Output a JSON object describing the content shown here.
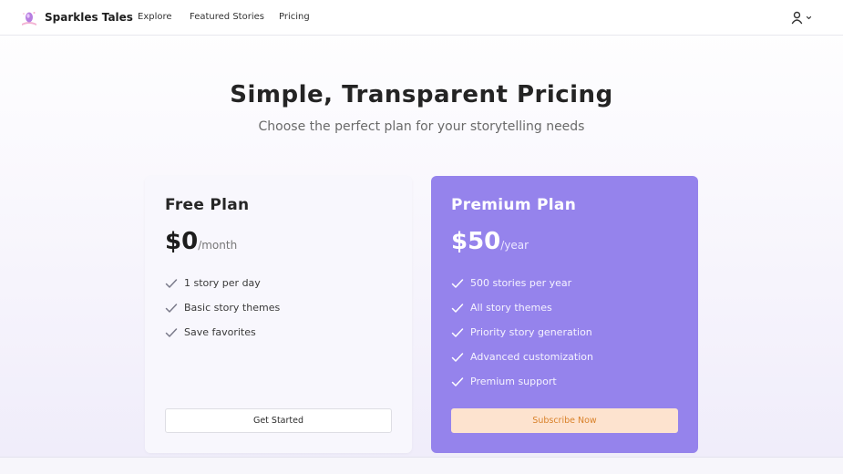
{
  "nav": {
    "brand": "Sparkles Tales",
    "links": [
      "Explore",
      "Featured Stories",
      "Pricing"
    ],
    "logo_icon": "sparkles-book-logo",
    "user_icon": "user-icon",
    "caret_icon": "chevron-down-icon"
  },
  "hero": {
    "title": "Simple, Transparent Pricing",
    "subtitle": "Choose the perfect plan for your storytelling needs"
  },
  "plans": [
    {
      "name": "Free Plan",
      "price": "$0",
      "period": "/month",
      "features": [
        "1 story per day",
        "Basic story themes",
        "Save favorites"
      ],
      "cta": "Get Started"
    },
    {
      "name": "Premium Plan",
      "price": "$50",
      "period": "/year",
      "features": [
        "500 stories per year",
        "All story themes",
        "Priority story generation",
        "Advanced customization",
        "Premium support"
      ],
      "cta": "Subscribe Now"
    }
  ],
  "colors": {
    "accent": "#9583ec",
    "cta_background": "#fde3cf",
    "cta_text": "#d9822b",
    "check_free": "#7a7a8a",
    "check_premium": "#ffffff"
  }
}
